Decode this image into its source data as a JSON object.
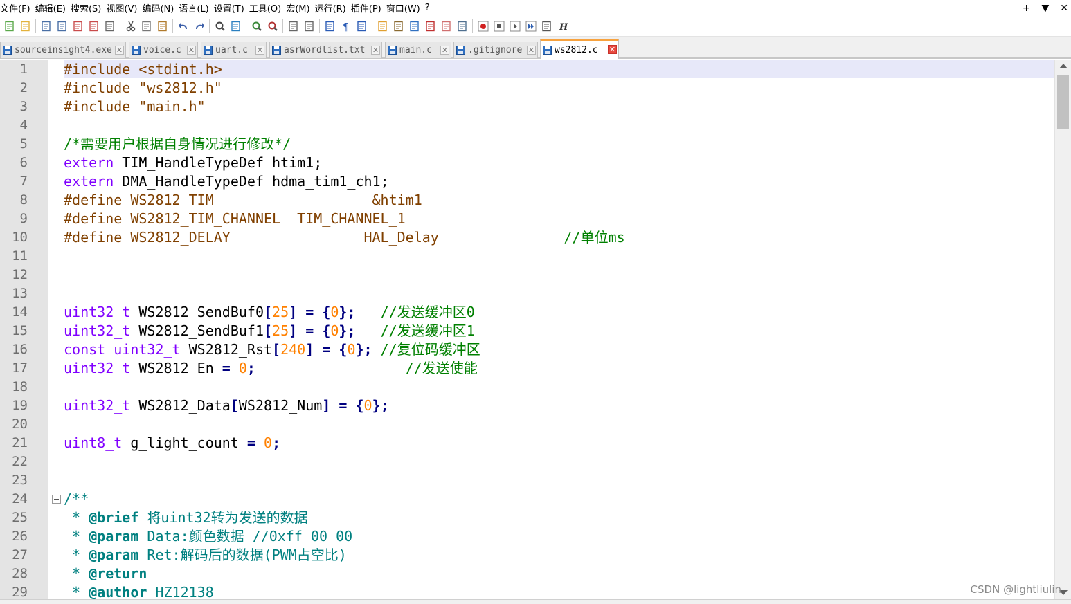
{
  "menu": [
    "文件(F)",
    "编辑(E)",
    "搜索(S)",
    "视图(V)",
    "编码(N)",
    "语言(L)",
    "设置(T)",
    "工具(O)",
    "宏(M)",
    "运行(R)",
    "插件(P)",
    "窗口(W)",
    "?"
  ],
  "window_controls": {
    "plus": "+",
    "dropdown": "▼",
    "close": "✕"
  },
  "toolbar_icons": [
    "new-file-icon",
    "open-file-icon",
    "save-icon",
    "save-all-icon",
    "close-icon",
    "close-all-icon",
    "print-icon",
    "cut-icon",
    "copy-icon",
    "paste-icon",
    "undo-icon",
    "redo-icon",
    "find-icon",
    "replace-icon",
    "zoom-in-icon",
    "zoom-out-icon",
    "sync-vertical-icon",
    "sync-horizontal-icon",
    "word-wrap-icon",
    "show-all-chars-icon",
    "indent-guide-icon",
    "folder-workspace-icon",
    "document-map-icon",
    "document-list-icon",
    "function-list-icon",
    "folder-icon",
    "monitor-icon",
    "record-macro-icon",
    "stop-record-icon",
    "play-macro-icon",
    "run-macro-multiple-icon",
    "save-macro-icon",
    "h-icon"
  ],
  "tabs": [
    {
      "label": "sourceinsight4.exe",
      "active": false
    },
    {
      "label": "voice.c",
      "active": false
    },
    {
      "label": "uart.c",
      "active": false
    },
    {
      "label": "asrWordlist.txt",
      "active": false
    },
    {
      "label": "main.c",
      "active": false
    },
    {
      "label": ".gitignore",
      "active": false
    },
    {
      "label": "ws2812.c",
      "active": true
    }
  ],
  "tab_close_glyph": "✕",
  "colors": {
    "preprocessor": "#804000",
    "keyword": "#8000ff",
    "number": "#ff8000",
    "string": "#808080",
    "operator": "#000080",
    "comment": "#008000",
    "doc_comment": "#008080",
    "active_tab_accent": "#f7a23e",
    "current_line": "#e7e8f9"
  },
  "code_lines": [
    [
      [
        "pp",
        "#include <stdint.h>"
      ]
    ],
    [
      [
        "pp",
        "#include \"ws2812.h\""
      ]
    ],
    [
      [
        "pp",
        "#include \"main.h\""
      ]
    ],
    [],
    [
      [
        "cm",
        "/*需要用户根据自身情况进行修改*/"
      ]
    ],
    [
      [
        "kw",
        "extern"
      ],
      [
        "p",
        " TIM_HandleTypeDef htim1;"
      ]
    ],
    [
      [
        "kw",
        "extern"
      ],
      [
        "p",
        " DMA_HandleTypeDef hdma_tim1_ch1;"
      ]
    ],
    [
      [
        "pp",
        "#define WS2812_TIM                   &htim1"
      ]
    ],
    [
      [
        "pp",
        "#define WS2812_TIM_CHANNEL  TIM_CHANNEL_1"
      ]
    ],
    [
      [
        "pp",
        "#define WS2812_DELAY                HAL_Delay"
      ],
      [
        "p",
        "               "
      ],
      [
        "cm",
        "//单位ms"
      ]
    ],
    [],
    [],
    [],
    [
      [
        "kw",
        "uint32_t"
      ],
      [
        "p",
        " WS2812_SendBuf0"
      ],
      [
        "op",
        "["
      ],
      [
        "num",
        "25"
      ],
      [
        "op",
        "]"
      ],
      [
        "p",
        " "
      ],
      [
        "op",
        "="
      ],
      [
        "p",
        " "
      ],
      [
        "op",
        "{"
      ],
      [
        "num",
        "0"
      ],
      [
        "op",
        "};"
      ],
      [
        "p",
        "   "
      ],
      [
        "cm",
        "//发送缓冲区0"
      ]
    ],
    [
      [
        "kw",
        "uint32_t"
      ],
      [
        "p",
        " WS2812_SendBuf1"
      ],
      [
        "op",
        "["
      ],
      [
        "num",
        "25"
      ],
      [
        "op",
        "]"
      ],
      [
        "p",
        " "
      ],
      [
        "op",
        "="
      ],
      [
        "p",
        " "
      ],
      [
        "op",
        "{"
      ],
      [
        "num",
        "0"
      ],
      [
        "op",
        "};"
      ],
      [
        "p",
        "   "
      ],
      [
        "cm",
        "//发送缓冲区1"
      ]
    ],
    [
      [
        "kw",
        "const"
      ],
      [
        "p",
        " "
      ],
      [
        "kw",
        "uint32_t"
      ],
      [
        "p",
        " WS2812_Rst"
      ],
      [
        "op",
        "["
      ],
      [
        "num",
        "240"
      ],
      [
        "op",
        "]"
      ],
      [
        "p",
        " "
      ],
      [
        "op",
        "="
      ],
      [
        "p",
        " "
      ],
      [
        "op",
        "{"
      ],
      [
        "num",
        "0"
      ],
      [
        "op",
        "};"
      ],
      [
        "p",
        " "
      ],
      [
        "cm",
        "//复位码缓冲区"
      ]
    ],
    [
      [
        "kw",
        "uint32_t"
      ],
      [
        "p",
        " WS2812_En "
      ],
      [
        "op",
        "="
      ],
      [
        "p",
        " "
      ],
      [
        "num",
        "0"
      ],
      [
        "op",
        ";"
      ],
      [
        "p",
        "                  "
      ],
      [
        "cm",
        "//发送使能"
      ]
    ],
    [],
    [
      [
        "kw",
        "uint32_t"
      ],
      [
        "p",
        " WS2812_Data"
      ],
      [
        "op",
        "["
      ],
      [
        "p",
        "WS2812_Num"
      ],
      [
        "op",
        "]"
      ],
      [
        "p",
        " "
      ],
      [
        "op",
        "="
      ],
      [
        "p",
        " "
      ],
      [
        "op",
        "{"
      ],
      [
        "num",
        "0"
      ],
      [
        "op",
        "};"
      ]
    ],
    [],
    [
      [
        "kw",
        "uint8_t"
      ],
      [
        "p",
        " g_light_count "
      ],
      [
        "op",
        "="
      ],
      [
        "p",
        " "
      ],
      [
        "num",
        "0"
      ],
      [
        "op",
        ";"
      ]
    ],
    [],
    [],
    [
      [
        "doc",
        "/**"
      ]
    ],
    [
      [
        "doc",
        " * "
      ],
      [
        "tag",
        "@brief"
      ],
      [
        "doc",
        " 将uint32转为发送的数据"
      ]
    ],
    [
      [
        "doc",
        " * "
      ],
      [
        "tag",
        "@param"
      ],
      [
        "doc",
        " Data:颜色数据 //0xff 00 00"
      ]
    ],
    [
      [
        "doc",
        " * "
      ],
      [
        "tag",
        "@param"
      ],
      [
        "doc",
        " Ret:解码后的数据(PWM占空比)"
      ]
    ],
    [
      [
        "doc",
        " * "
      ],
      [
        "tag",
        "@return"
      ]
    ],
    [
      [
        "doc",
        " * "
      ],
      [
        "tag",
        "@author"
      ],
      [
        "doc",
        " HZ12138"
      ]
    ]
  ],
  "watermark": "CSDN @lightliulin"
}
